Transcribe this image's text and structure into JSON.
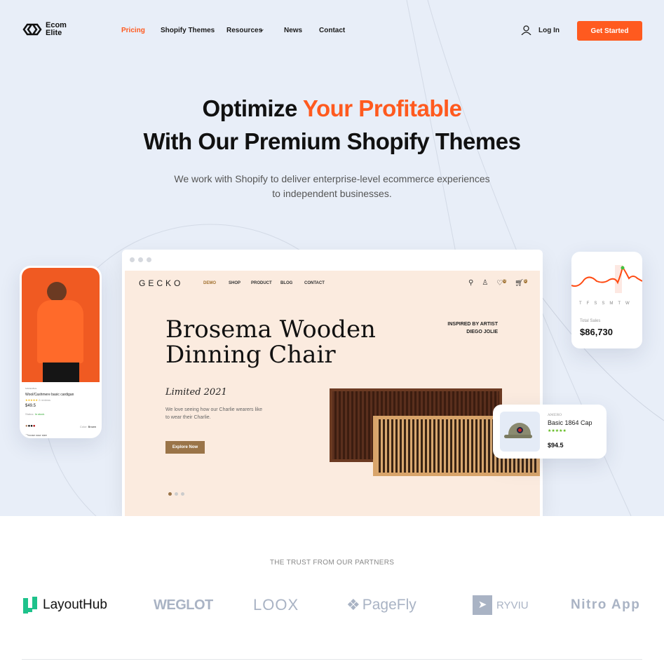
{
  "header": {
    "brand": "Ecom\nElite",
    "brand_line1": "Ecom",
    "brand_line2": "Elite",
    "nav": [
      "Pricing",
      "Shopify Themes",
      "Resources",
      "News",
      "Contact"
    ],
    "login": "Log In",
    "cta": "Get Started"
  },
  "hero": {
    "title_part1": "Optimize ",
    "title_accent": "Your Profitable",
    "title_line2": "With Our Premium Shopify Themes",
    "subtitle_line1": "We work with Shopify to deliver enterprise-level ecommerce experiences",
    "subtitle_line2": "to independent businesses."
  },
  "mockup": {
    "brand": "GECKO",
    "nav": [
      "DEMO",
      "SHOP",
      "PRODUCT",
      "BLOG",
      "CONTACT"
    ],
    "headline_line1": "Brosema Wooden",
    "headline_line2": "Dinning Chair",
    "inspired_line1": "INSPIRED BY ARTIST",
    "inspired_line2": "DIEGO JOLIE",
    "tagline": "Limited 2021",
    "description_line1": "We love seeing how our Charlie wearers like",
    "description_line2": "to wear their Charlie.",
    "button": "Explore Now",
    "wishlist_count": "0",
    "cart_count": "0"
  },
  "phone": {
    "brand": "MADEABLE",
    "product": "Wool/Cashmere basic cardigan",
    "reviews": "2 reviews",
    "price": "$49.5",
    "status_label": "Status:",
    "status": "In stock",
    "color_label": "Color:",
    "color": "Brown",
    "size_guide": "Choose your size"
  },
  "sales_card": {
    "days": [
      "T",
      "F",
      "S",
      "S",
      "M",
      "T",
      "W"
    ],
    "label": "Total Sales",
    "value": "$86,730"
  },
  "product_card": {
    "brand": "AMERO",
    "name": "Basic 1864 Cap",
    "rating": "★★★★★",
    "price": "$94.5"
  },
  "partners": {
    "heading": "THE TRUST FROM OUR PARTNERS",
    "logos": [
      "LayoutHub",
      "WEGLOT",
      "LOOX",
      "PageFly",
      "RYVIU",
      "Nitro App"
    ]
  },
  "colors": {
    "accent": "#ff5a1f",
    "mockup_bg": "#fbebdf",
    "mockup_button": "#9a7448"
  }
}
